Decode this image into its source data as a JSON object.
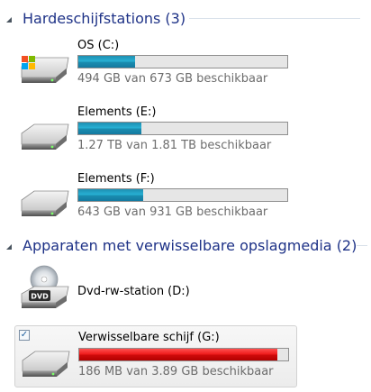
{
  "groups": [
    {
      "title": "Hardeschijfstations (3)"
    },
    {
      "title": "Apparaten met verwisselbare opslagmedia (2)"
    }
  ],
  "drives": [
    {
      "name": "OS (C:)",
      "info": "494 GB van 673 GB beschikbaar",
      "used_fraction": 0.27,
      "bar_color": "#1f9cc3",
      "icon": "windows-drive-icon"
    },
    {
      "name": "Elements (E:)",
      "info": "1.27 TB van 1.81 TB beschikbaar",
      "used_fraction": 0.3,
      "bar_color": "#1f9cc3",
      "icon": "hard-drive-icon"
    },
    {
      "name": "Elements (F:)",
      "info": "643 GB van 931 GB beschikbaar",
      "used_fraction": 0.31,
      "bar_color": "#1f9cc3",
      "icon": "hard-drive-icon"
    }
  ],
  "removable": [
    {
      "name": "Dvd-rw-station (D:)",
      "icon": "dvd-drive-icon",
      "icon_label": "DVD"
    },
    {
      "name": "Verwisselbare schijf (G:)",
      "info": "186 MB van 3.89 GB beschikbaar",
      "used_fraction": 0.95,
      "bar_color": "#e01414",
      "icon": "removable-drive-icon",
      "checked": true
    }
  ]
}
